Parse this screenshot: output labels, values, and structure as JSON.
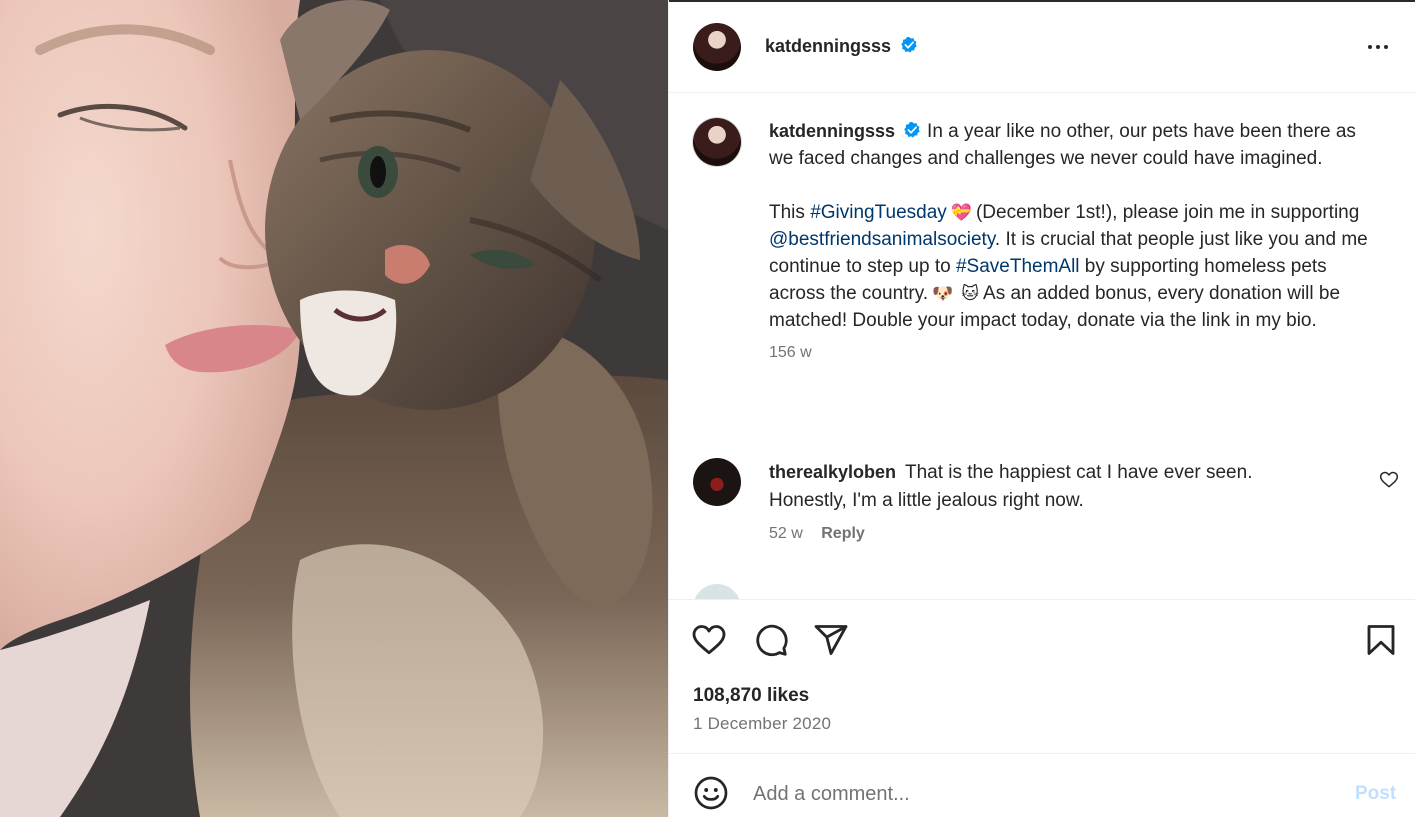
{
  "post": {
    "author": "katdenningsss",
    "author_verified": true,
    "more_icon": "more-options-icon",
    "caption_p1": "In a year like no other, our pets have been there as we faced changes and challenges we never could have imagined.",
    "caption_p2_a": "This ",
    "caption_tag1": "#GivingTuesday",
    "caption_emoji1": "💝",
    "caption_p2_b": "(December 1st!), please join me in supporting ",
    "caption_mention": "@bestfriendsanimalsociety",
    "caption_p2_c": ". It is crucial that people just like you and me continue to step up to ",
    "caption_tag2": "#SaveThemAll",
    "caption_p2_d": " by supporting homeless pets across the country.",
    "caption_emoji2": "🐶",
    "caption_emoji3": "🐱",
    "caption_p2_e": "As an added bonus, every donation will be matched! Double your impact today, donate via the link in my bio.",
    "time_ago": "156 w"
  },
  "comments": [
    {
      "username": "therealkyloben",
      "text": "That is the happiest cat I have ever seen. Honestly, I'm a little jealous right now.",
      "time_ago": "52 w",
      "reply_label": "Reply"
    }
  ],
  "actions": {
    "like_icon": "heart-icon",
    "comment_icon": "comment-icon",
    "share_icon": "share-icon",
    "save_icon": "bookmark-icon"
  },
  "likes_text": "108,870 likes",
  "date_text": "1 December 2020",
  "composer": {
    "placeholder": "Add a comment...",
    "post_label": "Post",
    "emoji_icon": "emoji-icon"
  },
  "colors": {
    "link": "#00376b",
    "verified": "#0095f6",
    "muted": "#737373",
    "post_disabled": "#c1e0fd"
  }
}
